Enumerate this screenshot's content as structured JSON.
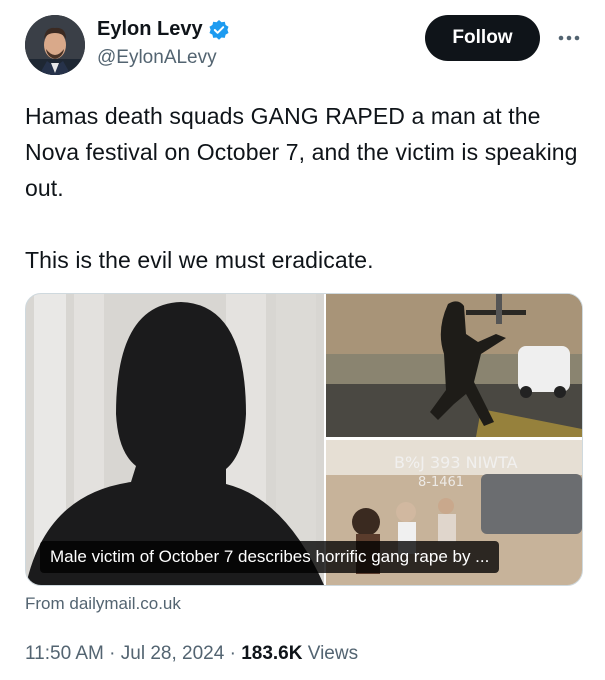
{
  "author": {
    "name": "Eylon Levy",
    "handle": "@EylonALevy",
    "verified": true
  },
  "follow_label": "Follow",
  "more_icon": "more-icon",
  "tweet": {
    "paragraph_1": "Hamas death squads GANG RAPED a man at the Nova festival on October 7, and the victim is speaking out.",
    "paragraph_2": "This is the evil we must eradicate."
  },
  "link_card": {
    "caption": "Male victim of October 7 describes horrific gang rape by ...",
    "source": "From dailymail.co.uk"
  },
  "meta": {
    "time": "11:50 AM",
    "separator": "·",
    "date": "Jul 28, 2024",
    "views_count": "183.6K",
    "views_label": "Views"
  },
  "colors": {
    "text_primary": "#0f1419",
    "text_secondary": "#536471",
    "verified_blue": "#1d9bf0",
    "follow_bg": "#0f1419"
  }
}
